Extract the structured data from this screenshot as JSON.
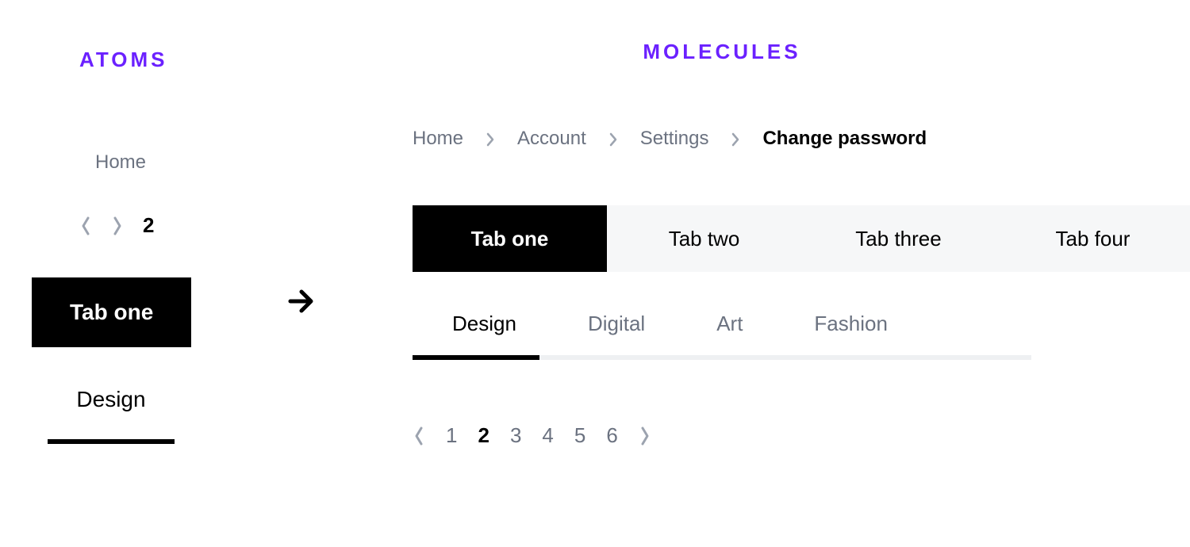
{
  "titles": {
    "atoms": "ATOMS",
    "molecules": "MOLECULES"
  },
  "atoms": {
    "breadcrumb": "Home",
    "pagination_current": "2",
    "pill_tab": "Tab one",
    "underline_tab": "Design"
  },
  "molecules": {
    "breadcrumb": {
      "items": [
        "Home",
        "Account",
        "Settings"
      ],
      "current": "Change password"
    },
    "pill_tabs": {
      "items": [
        "Tab one",
        "Tab two",
        "Tab three",
        "Tab four"
      ],
      "active_index": 0
    },
    "underline_tabs": {
      "items": [
        "Design",
        "Digital",
        "Art",
        "Fashion"
      ],
      "active_index": 0
    },
    "pagination": {
      "pages": [
        "1",
        "2",
        "3",
        "4",
        "5",
        "6"
      ],
      "current": "2"
    }
  }
}
